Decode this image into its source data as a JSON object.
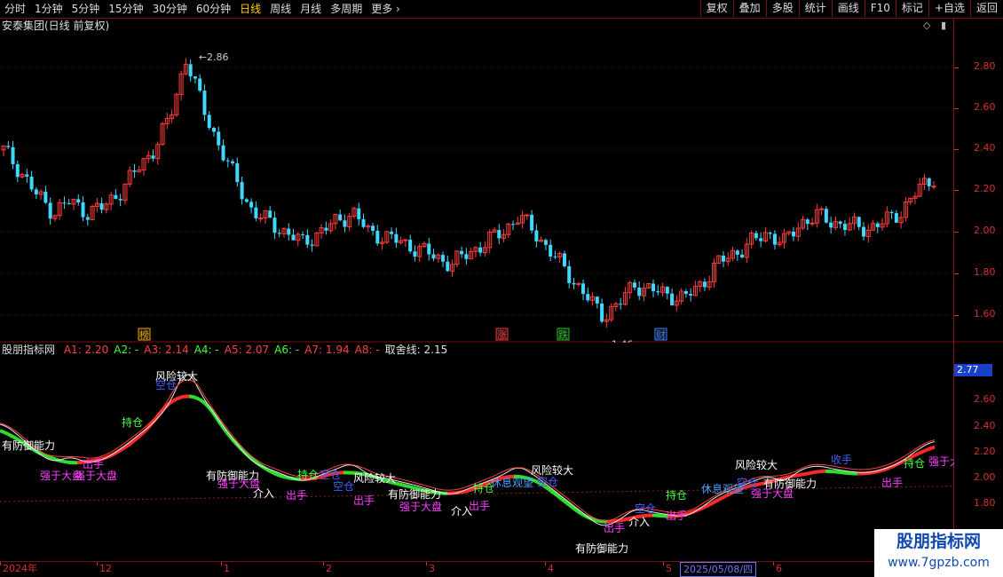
{
  "toolbar": {
    "periods": [
      "分时",
      "1分钟",
      "5分钟",
      "15分钟",
      "30分钟",
      "60分钟",
      "日线",
      "周线",
      "月线",
      "多周期",
      "更多"
    ],
    "active_period": "日线",
    "right_buttons": [
      "复权",
      "叠加",
      "多股",
      "统计",
      "画线",
      "F10",
      "标记",
      "+自选",
      "返回"
    ]
  },
  "main_chart": {
    "title": "安泰集团(日线 前复权)",
    "y_ticks": [
      "2.80",
      "2.60",
      "2.40",
      "2.20",
      "2.00",
      "1.80",
      "1.60"
    ],
    "high_label": "2.86",
    "low_label": "1.46",
    "markers": [
      {
        "text": "榜",
        "color": "#f0a000"
      },
      {
        "text": "涨",
        "color": "#ff3030"
      },
      {
        "text": "跌",
        "color": "#20c020"
      },
      {
        "text": "财",
        "color": "#3080ff"
      }
    ]
  },
  "indicator": {
    "name": "股朋指标网",
    "params": [
      {
        "label": "A1: 2.20",
        "color": "#ff4040"
      },
      {
        "label": "A2: -",
        "color": "#40ff40"
      },
      {
        "label": "A3: 2.14",
        "color": "#ff4040"
      },
      {
        "label": "A4: -",
        "color": "#40ff40"
      },
      {
        "label": "A5: 2.07",
        "color": "#ff4040"
      },
      {
        "label": "A6: -",
        "color": "#40ff40"
      },
      {
        "label": "A7: 1.94",
        "color": "#ff4040"
      },
      {
        "label": "A8: -",
        "color": "#ff4040"
      },
      {
        "label": "取舍线: 2.15",
        "color": "#e0e0e0"
      }
    ],
    "y_ticks": [
      "2.60",
      "2.40",
      "2.20",
      "2.00",
      "1.80"
    ],
    "current_value": "2.77",
    "labels": [
      {
        "text": "风险较大",
        "color": "#ffffff"
      },
      {
        "text": "空仓",
        "color": "#4060ff"
      },
      {
        "text": "持仓",
        "color": "#40ff40"
      },
      {
        "text": "有防御能力",
        "color": "#ffffff"
      },
      {
        "text": "强于大盘",
        "color": "#ff40ff"
      },
      {
        "text": "出手",
        "color": "#ff40ff"
      },
      {
        "text": "介入",
        "color": "#ffffff"
      },
      {
        "text": "休息观望",
        "color": "#4aa0ff"
      },
      {
        "text": "收手",
        "color": "#4060ff"
      }
    ]
  },
  "date_axis": {
    "labels": [
      "2024年",
      "12",
      "1",
      "2",
      "3",
      "4",
      "5",
      "6"
    ],
    "selected_date": "2025/05/08/四"
  },
  "watermark": {
    "title": "股朋指标网",
    "url": "www.7gpzb.com"
  },
  "chart_data": {
    "type": "candlestick",
    "title": "安泰集团(日线 前复权)",
    "y_range": [
      1.46,
      2.86
    ],
    "y_ticks": [
      2.8,
      2.6,
      2.4,
      2.2,
      2.0,
      1.8,
      1.6
    ],
    "x_labels": [
      "2024年",
      "12",
      "1",
      "2",
      "3",
      "4",
      "5",
      "6"
    ],
    "high": 2.86,
    "low": 1.46,
    "close_path": [
      2.4,
      2.3,
      2.18,
      2.1,
      2.15,
      2.1,
      2.12,
      2.2,
      2.3,
      2.4,
      2.55,
      2.85,
      2.6,
      2.42,
      2.25,
      2.1,
      2.05,
      2.0,
      1.95,
      2.0,
      2.05,
      2.1,
      2.0,
      1.98,
      1.95,
      1.92,
      1.88,
      1.85,
      1.9,
      1.95,
      2.0,
      2.08,
      2.0,
      1.9,
      1.8,
      1.7,
      1.6,
      1.65,
      1.75,
      1.72,
      1.7,
      1.68,
      1.75,
      1.85,
      1.9,
      1.95,
      2.0,
      1.95,
      2.05,
      2.08,
      2.05,
      2.03,
      2.02,
      2.05,
      2.1,
      2.2,
      2.27
    ]
  }
}
